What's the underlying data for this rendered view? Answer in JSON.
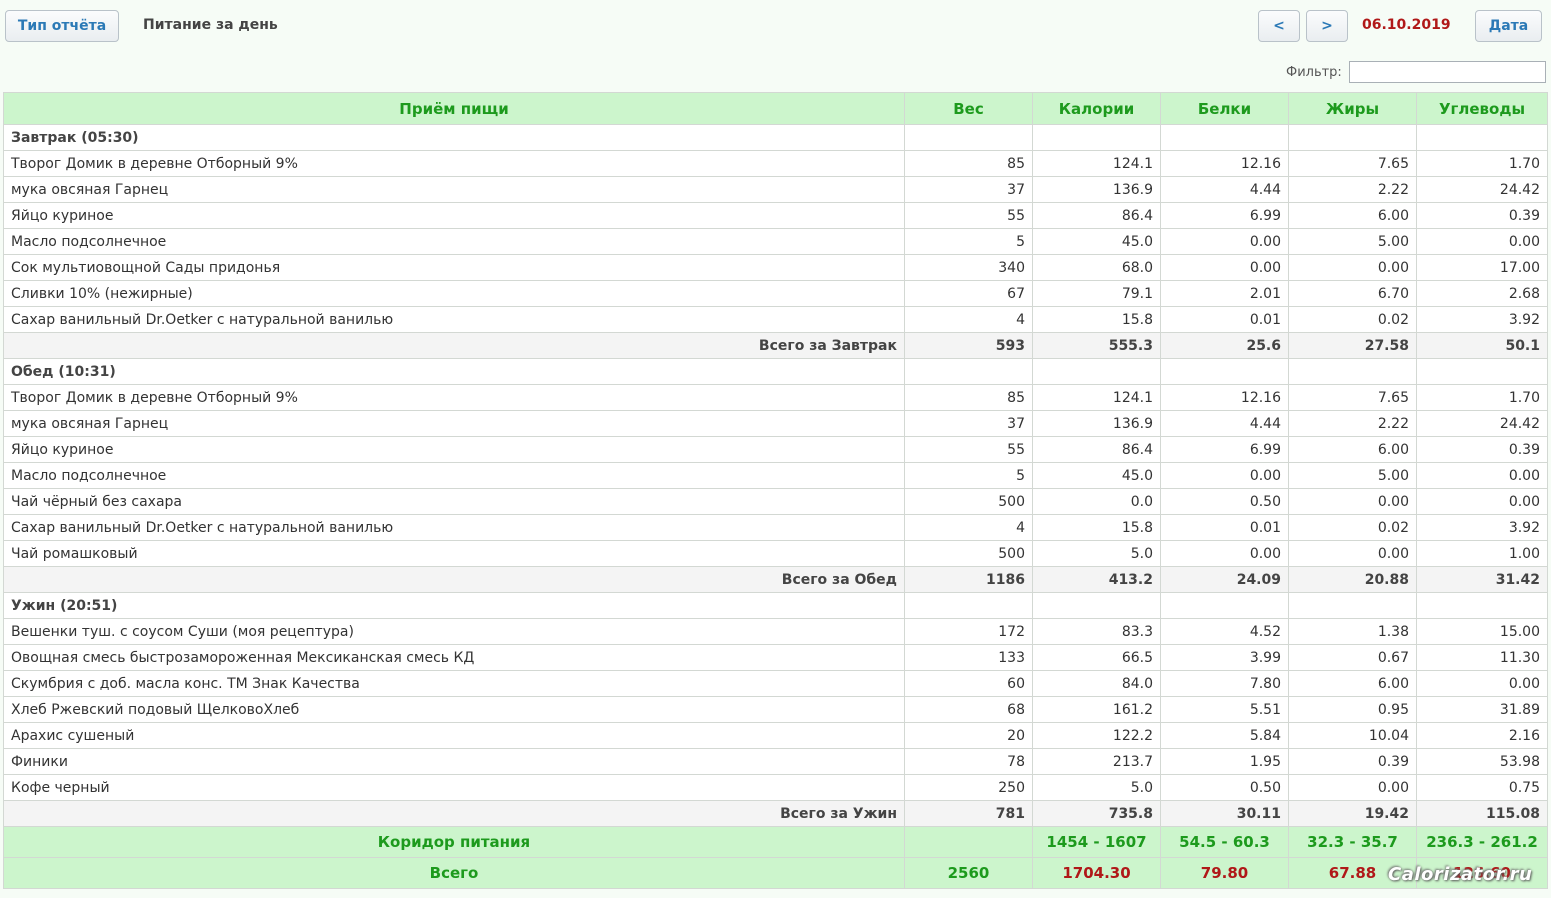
{
  "toolbar": {
    "report_type_label": "Тип отчёта",
    "title": "Питание за день",
    "prev_label": "<",
    "next_label": ">",
    "date": "06.10.2019",
    "date_button_label": "Дата"
  },
  "filter": {
    "label": "Фильтр:",
    "value": ""
  },
  "table": {
    "headers": [
      "Приём пищи",
      "Вес",
      "Калории",
      "Белки",
      "Жиры",
      "Углеводы"
    ],
    "meals": [
      {
        "title": "Завтрак (05:30)",
        "items": [
          [
            "Творог Домик в деревне Отборный 9%",
            "85",
            "124.1",
            "12.16",
            "7.65",
            "1.70"
          ],
          [
            "мука овсяная Гарнец",
            "37",
            "136.9",
            "4.44",
            "2.22",
            "24.42"
          ],
          [
            "Яйцо куриное",
            "55",
            "86.4",
            "6.99",
            "6.00",
            "0.39"
          ],
          [
            "Масло подсолнечное",
            "5",
            "45.0",
            "0.00",
            "5.00",
            "0.00"
          ],
          [
            "Сок мультиовощной Сады придонья",
            "340",
            "68.0",
            "0.00",
            "0.00",
            "17.00"
          ],
          [
            "Сливки 10% (нежирные)",
            "67",
            "79.1",
            "2.01",
            "6.70",
            "2.68"
          ],
          [
            "Сахар ванильный Dr.Oetker с натуральной ванилью",
            "4",
            "15.8",
            "0.01",
            "0.02",
            "3.92"
          ]
        ],
        "total": [
          "Всего за Завтрак",
          "593",
          "555.3",
          "25.6",
          "27.58",
          "50.1"
        ]
      },
      {
        "title": "Обед (10:31)",
        "items": [
          [
            "Творог Домик в деревне Отборный 9%",
            "85",
            "124.1",
            "12.16",
            "7.65",
            "1.70"
          ],
          [
            "мука овсяная Гарнец",
            "37",
            "136.9",
            "4.44",
            "2.22",
            "24.42"
          ],
          [
            "Яйцо куриное",
            "55",
            "86.4",
            "6.99",
            "6.00",
            "0.39"
          ],
          [
            "Масло подсолнечное",
            "5",
            "45.0",
            "0.00",
            "5.00",
            "0.00"
          ],
          [
            "Чай чёрный без сахара",
            "500",
            "0.0",
            "0.50",
            "0.00",
            "0.00"
          ],
          [
            "Сахар ванильный Dr.Oetker с натуральной ванилью",
            "4",
            "15.8",
            "0.01",
            "0.02",
            "3.92"
          ],
          [
            "Чай ромашковый",
            "500",
            "5.0",
            "0.00",
            "0.00",
            "1.00"
          ]
        ],
        "total": [
          "Всего за Обед",
          "1186",
          "413.2",
          "24.09",
          "20.88",
          "31.42"
        ]
      },
      {
        "title": "Ужин (20:51)",
        "items": [
          [
            "Вешенки туш. с соусом Суши (моя рецептура)",
            "172",
            "83.3",
            "4.52",
            "1.38",
            "15.00"
          ],
          [
            "Овощная смесь быстрозамороженная Мексиканская смесь КД",
            "133",
            "66.5",
            "3.99",
            "0.67",
            "11.30"
          ],
          [
            "Скумбрия с доб. масла конс. ТМ Знак Качества",
            "60",
            "84.0",
            "7.80",
            "6.00",
            "0.00"
          ],
          [
            "Хлеб Ржевский подовый ЩелковоХлеб",
            "68",
            "161.2",
            "5.51",
            "0.95",
            "31.89"
          ],
          [
            "Арахис сушеный",
            "20",
            "122.2",
            "5.84",
            "10.04",
            "2.16"
          ],
          [
            "Финики",
            "78",
            "213.7",
            "1.95",
            "0.39",
            "53.98"
          ],
          [
            "Кофе черный",
            "250",
            "5.0",
            "0.50",
            "0.00",
            "0.75"
          ]
        ],
        "total": [
          "Всего за Ужин",
          "781",
          "735.8",
          "30.11",
          "19.42",
          "115.08"
        ]
      }
    ],
    "corridor": [
      "Коридор питания",
      "",
      "1454 - 1607",
      "54.5 - 60.3",
      "32.3 - 35.7",
      "236.3 - 261.2"
    ],
    "grand_total": [
      "Всего",
      "2560",
      "1704.30",
      "79.80",
      "67.88",
      "126.60"
    ]
  },
  "watermark": "Calorizator.ru",
  "colors": {
    "header_bg": "#ccf5cc",
    "header_text": "#1d9a1d",
    "accent_red": "#b01818",
    "button_text": "#2b79b6"
  }
}
